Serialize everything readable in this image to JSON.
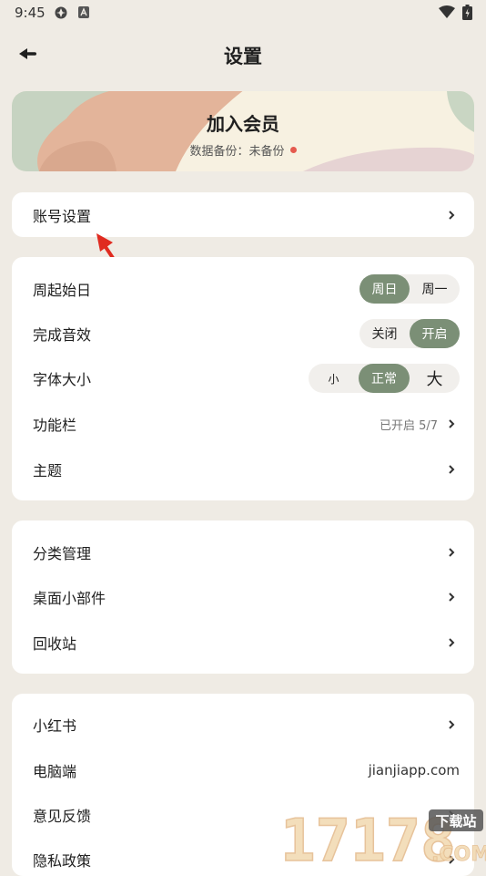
{
  "status_bar": {
    "time": "9:45"
  },
  "header": {
    "title": "设置"
  },
  "member": {
    "title": "加入会员",
    "subtitle": "数据备份：未备份"
  },
  "account": {
    "label": "账号设置"
  },
  "prefs": {
    "week_start": {
      "label": "周起始日",
      "options": [
        "周日",
        "周一"
      ],
      "selected": "周日"
    },
    "sound": {
      "label": "完成音效",
      "options": [
        "关闭",
        "开启"
      ],
      "selected": "开启"
    },
    "font_size": {
      "label": "字体大小",
      "options": [
        "小",
        "正常",
        "大"
      ],
      "selected": "正常"
    },
    "toolbar": {
      "label": "功能栏",
      "value": "已开启 5/7"
    },
    "theme": {
      "label": "主题"
    }
  },
  "manage": {
    "category": "分类管理",
    "widget": "桌面小部件",
    "trash": "回收站"
  },
  "misc": {
    "xiaohongshu": "小红书",
    "desktop": {
      "label": "电脑端",
      "value": "jianjiapp.com"
    },
    "feedback": "意见反馈",
    "privacy": "隐私政策"
  },
  "watermark": {
    "digits": "17178",
    "tag": "下载站",
    "suffix": ".COM"
  },
  "colors": {
    "accent": "#7b8f76",
    "background": "#efebe4",
    "dot": "#e55a4e",
    "arrow": "#e02b20"
  }
}
